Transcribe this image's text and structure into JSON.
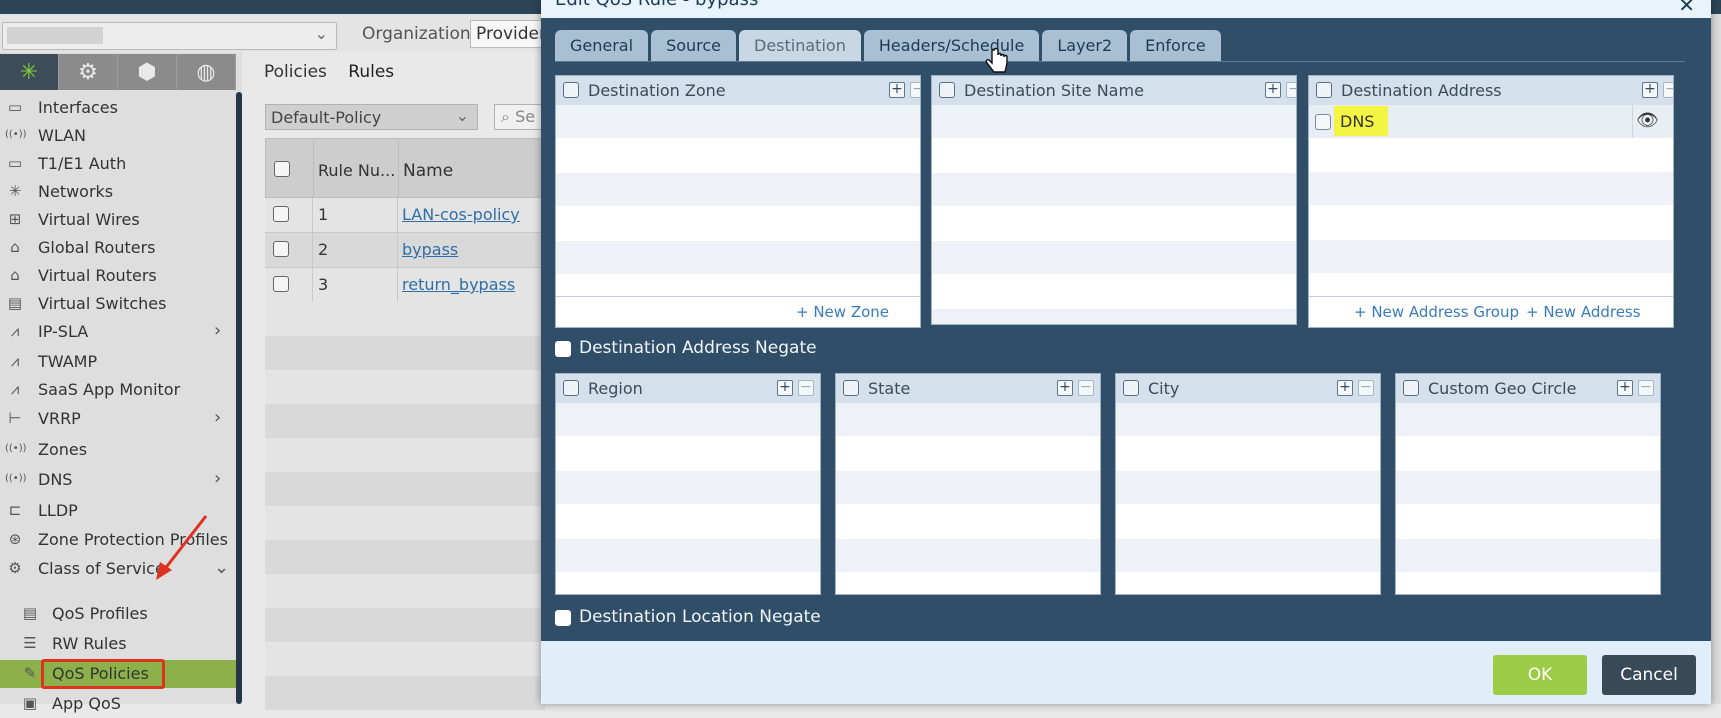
{
  "background": {
    "org_label": "Organization:",
    "org_value": "Provider",
    "sidebar_items": [
      {
        "label": "Interfaces",
        "icon": "interface-icon",
        "arrow": false
      },
      {
        "label": "WLAN",
        "icon": "wifi-icon",
        "arrow": false
      },
      {
        "label": "T1/E1 Auth",
        "icon": "interface-icon",
        "arrow": false
      },
      {
        "label": "Networks",
        "icon": "network-icon",
        "arrow": false
      },
      {
        "label": "Virtual Wires",
        "icon": "wire-icon",
        "arrow": false
      },
      {
        "label": "Global Routers",
        "icon": "router-icon",
        "arrow": false
      },
      {
        "label": "Virtual Routers",
        "icon": "router-icon",
        "arrow": false
      },
      {
        "label": "Virtual Switches",
        "icon": "switch-icon",
        "arrow": false
      },
      {
        "label": "IP-SLA",
        "icon": "chart-icon",
        "arrow": true
      },
      {
        "label": "TWAMP",
        "icon": "chart-icon",
        "arrow": false
      },
      {
        "label": "SaaS App Monitor",
        "icon": "chart-icon",
        "arrow": false
      },
      {
        "label": "VRRP",
        "icon": "tree-icon",
        "arrow": true
      },
      {
        "label": "Zones",
        "icon": "wifi-icon",
        "arrow": false
      },
      {
        "label": "DNS",
        "icon": "wifi-icon",
        "arrow": true
      },
      {
        "label": "LLDP",
        "icon": "lldp-icon",
        "arrow": false
      },
      {
        "label": "Zone Protection Profiles",
        "icon": "shield-icon",
        "arrow": false
      },
      {
        "label": "Class of Service",
        "icon": "gear-icon",
        "arrow": "down"
      }
    ],
    "sidebar_sub_items": [
      {
        "label": "QoS Profiles",
        "icon": "profile-icon"
      },
      {
        "label": "RW Rules",
        "icon": "rules-icon"
      },
      {
        "label": "QoS Policies",
        "icon": "policy-icon"
      },
      {
        "label": "App QoS",
        "icon": "app-icon"
      }
    ],
    "subtabs": [
      "Policies",
      "Rules"
    ],
    "policy_select": "Default-Policy",
    "search_placeholder": "Se",
    "table": {
      "headers": [
        "Rule Nu...",
        "Name"
      ],
      "rows": [
        {
          "num": "1",
          "name": "LAN-cos-policy"
        },
        {
          "num": "2",
          "name": "bypass"
        },
        {
          "num": "3",
          "name": "return_bypass"
        }
      ]
    }
  },
  "modal": {
    "title": "Edit QoS Rule - bypass",
    "tabs": [
      "General",
      "Source",
      "Destination",
      "Headers/Schedule",
      "Layer2",
      "Enforce"
    ],
    "active_tab": "Destination",
    "panels_top": [
      {
        "title": "Destination Zone",
        "links": [
          "+ New Zone"
        ]
      },
      {
        "title": "Destination Site Name",
        "links": []
      },
      {
        "title": "Destination Address",
        "links": [
          "+ New Address Group",
          "+ New Address"
        ],
        "entries": [
          "DNS"
        ]
      }
    ],
    "address_negate": "Destination Address Negate",
    "panels_geo": [
      {
        "title": "Region"
      },
      {
        "title": "State"
      },
      {
        "title": "City"
      },
      {
        "title": "Custom Geo Circle"
      }
    ],
    "location_negate": "Destination Location Negate",
    "ok_label": "OK",
    "cancel_label": "Cancel",
    "highlight_color": "#f4f542",
    "accent_ok": "#9ccb45"
  }
}
